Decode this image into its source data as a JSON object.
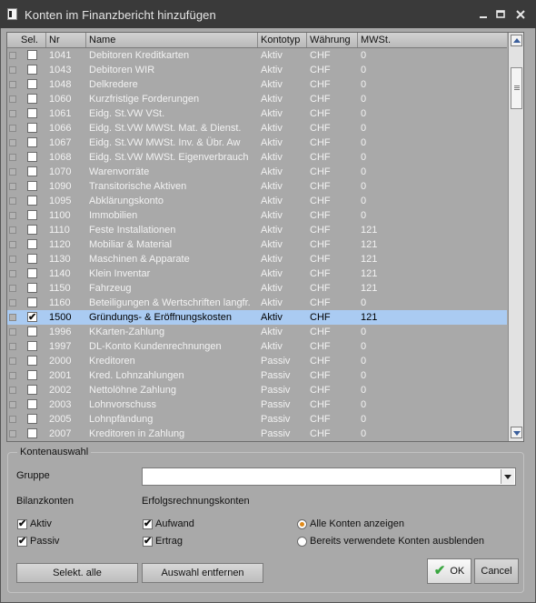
{
  "window": {
    "title": "Konten im Finanzbericht  hinzufügen",
    "icon": "document-icon"
  },
  "grid": {
    "columns": [
      "Sel.",
      "Nr",
      "Name",
      "Kontotyp",
      "Währung",
      "MWSt."
    ],
    "rows": [
      {
        "nr": "1041",
        "name": "Debitoren Kreditkarten",
        "typ": "Aktiv",
        "cur": "CHF",
        "mwst": "0",
        "sel": false
      },
      {
        "nr": "1043",
        "name": "Debitoren WIR",
        "typ": "Aktiv",
        "cur": "CHF",
        "mwst": "0",
        "sel": false
      },
      {
        "nr": "1048",
        "name": "Delkredere",
        "typ": "Aktiv",
        "cur": "CHF",
        "mwst": "0",
        "sel": false
      },
      {
        "nr": "1060",
        "name": "Kurzfristige Forderungen",
        "typ": "Aktiv",
        "cur": "CHF",
        "mwst": "0",
        "sel": false
      },
      {
        "nr": "1061",
        "name": "Eidg. St.VW VSt.",
        "typ": "Aktiv",
        "cur": "CHF",
        "mwst": "0",
        "sel": false
      },
      {
        "nr": "1066",
        "name": "Eidg. St.VW MWSt. Mat. & Dienst.",
        "typ": "Aktiv",
        "cur": "CHF",
        "mwst": "0",
        "sel": false
      },
      {
        "nr": "1067",
        "name": "Eidg. St.VW MWSt. Inv. & Übr. Aw",
        "typ": "Aktiv",
        "cur": "CHF",
        "mwst": "0",
        "sel": false
      },
      {
        "nr": "1068",
        "name": "Eidg. St.VW MWSt. Eigenverbrauch",
        "typ": "Aktiv",
        "cur": "CHF",
        "mwst": "0",
        "sel": false
      },
      {
        "nr": "1070",
        "name": "Warenvorräte",
        "typ": "Aktiv",
        "cur": "CHF",
        "mwst": "0",
        "sel": false
      },
      {
        "nr": "1090",
        "name": "Transitorische Aktiven",
        "typ": "Aktiv",
        "cur": "CHF",
        "mwst": "0",
        "sel": false
      },
      {
        "nr": "1095",
        "name": "Abklärungskonto",
        "typ": "Aktiv",
        "cur": "CHF",
        "mwst": "0",
        "sel": false
      },
      {
        "nr": "1100",
        "name": "Immobilien",
        "typ": "Aktiv",
        "cur": "CHF",
        "mwst": "0",
        "sel": false
      },
      {
        "nr": "1110",
        "name": "Feste Installationen",
        "typ": "Aktiv",
        "cur": "CHF",
        "mwst": "121",
        "sel": false
      },
      {
        "nr": "1120",
        "name": "Mobiliar & Material",
        "typ": "Aktiv",
        "cur": "CHF",
        "mwst": "121",
        "sel": false
      },
      {
        "nr": "1130",
        "name": "Maschinen & Apparate",
        "typ": "Aktiv",
        "cur": "CHF",
        "mwst": "121",
        "sel": false
      },
      {
        "nr": "1140",
        "name": "Klein Inventar",
        "typ": "Aktiv",
        "cur": "CHF",
        "mwst": "121",
        "sel": false
      },
      {
        "nr": "1150",
        "name": "Fahrzeug",
        "typ": "Aktiv",
        "cur": "CHF",
        "mwst": "121",
        "sel": false
      },
      {
        "nr": "1160",
        "name": "Beteiligungen & Wertschriften langfr.",
        "typ": "Aktiv",
        "cur": "CHF",
        "mwst": "0",
        "sel": false
      },
      {
        "nr": "1500",
        "name": "Gründungs- & Eröffnungskosten",
        "typ": "Aktiv",
        "cur": "CHF",
        "mwst": "121",
        "sel": true
      },
      {
        "nr": "1996",
        "name": "KKarten-Zahlung",
        "typ": "Aktiv",
        "cur": "CHF",
        "mwst": "0",
        "sel": false
      },
      {
        "nr": "1997",
        "name": "DL-Konto Kundenrechnungen",
        "typ": "Aktiv",
        "cur": "CHF",
        "mwst": "0",
        "sel": false
      },
      {
        "nr": "2000",
        "name": "Kreditoren",
        "typ": "Passiv",
        "cur": "CHF",
        "mwst": "0",
        "sel": false
      },
      {
        "nr": "2001",
        "name": "Kred. Lohnzahlungen",
        "typ": "Passiv",
        "cur": "CHF",
        "mwst": "0",
        "sel": false
      },
      {
        "nr": "2002",
        "name": "Nettolöhne Zahlung",
        "typ": "Passiv",
        "cur": "CHF",
        "mwst": "0",
        "sel": false
      },
      {
        "nr": "2003",
        "name": "Lohnvorschuss",
        "typ": "Passiv",
        "cur": "CHF",
        "mwst": "0",
        "sel": false
      },
      {
        "nr": "2005",
        "name": "Lohnpfändung",
        "typ": "Passiv",
        "cur": "CHF",
        "mwst": "0",
        "sel": false
      },
      {
        "nr": "2007",
        "name": "Kreditoren in Zahlung",
        "typ": "Passiv",
        "cur": "CHF",
        "mwst": "0",
        "sel": false
      }
    ],
    "selected_row_color": "#aacbf2"
  },
  "kontenauswahl": {
    "legend": "Kontenauswahl",
    "gruppe_label": "Gruppe",
    "gruppe_value": "",
    "bilanzkonten_label": "Bilanzkonten",
    "erfolgsrechnungskonten_label": "Erfolgsrechnungskonten",
    "aktiv_label": "Aktiv",
    "aktiv_checked": true,
    "passiv_label": "Passiv",
    "passiv_checked": true,
    "aufwand_label": "Aufwand",
    "aufwand_checked": true,
    "ertrag_label": "Ertrag",
    "ertrag_checked": true,
    "radio_all_label": "Alle Konten anzeigen",
    "radio_hide_label": "Bereits verwendete Konten ausblenden",
    "radio_selected": "all"
  },
  "buttons": {
    "select_all": "Selekt. alle",
    "clear_selection": "Auswahl entfernen",
    "ok": "OK",
    "cancel": "Cancel"
  }
}
